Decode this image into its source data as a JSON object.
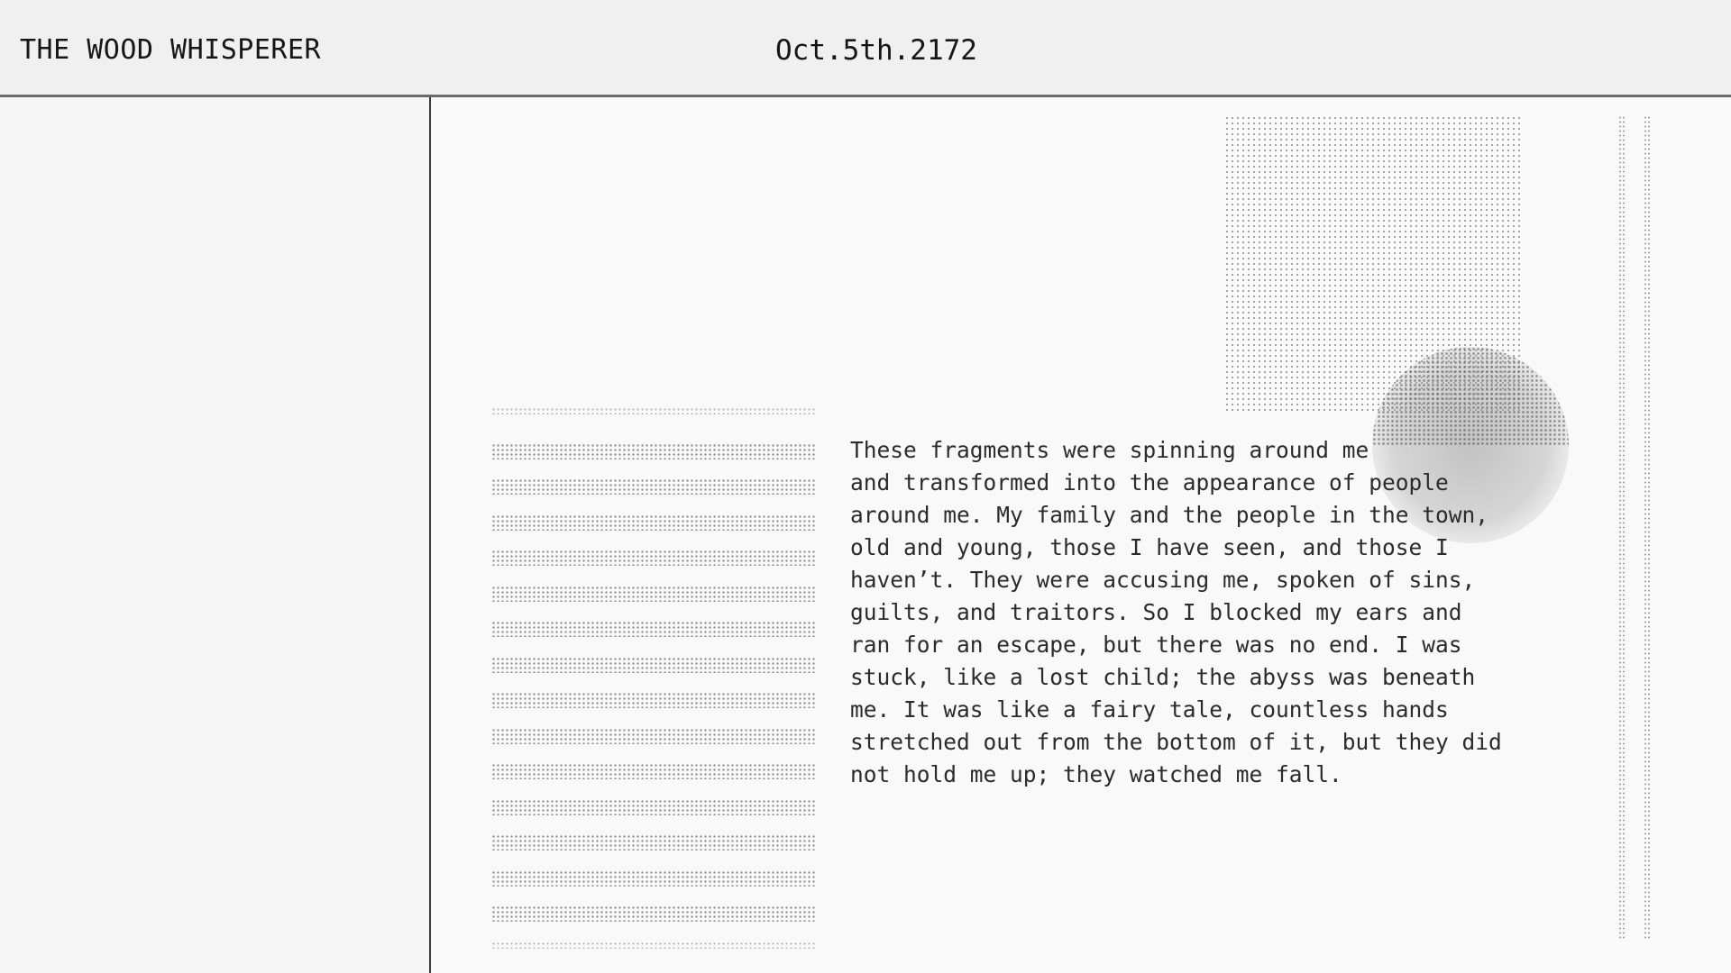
{
  "header": {
    "title": "THE WOOD WHISPERER",
    "date": "Oct.5th.2172"
  },
  "story": {
    "lines": [
      "These fragments were spinning around me",
      "and transformed into the appearance of people",
      "around me. My family and the people in the town,",
      "old and young, those I have seen, and those I",
      "haven’t. They were accusing me, spoken of sins,",
      "guilts, and traitors. So I blocked my ears and",
      "ran for an escape, but there was no end. I was",
      "stuck, like a lost child; the abyss was beneath",
      "me. It was like a fairy tale, countless hands",
      "stretched out from the bottom of it, but they did",
      "not hold me up; they watched me fall."
    ]
  },
  "decor": {
    "halftone_rect": "dotted-square",
    "halftone_circle": "dotted-sphere",
    "stripes": "halftone-stripes",
    "accent_color": "#6a6a6a"
  }
}
